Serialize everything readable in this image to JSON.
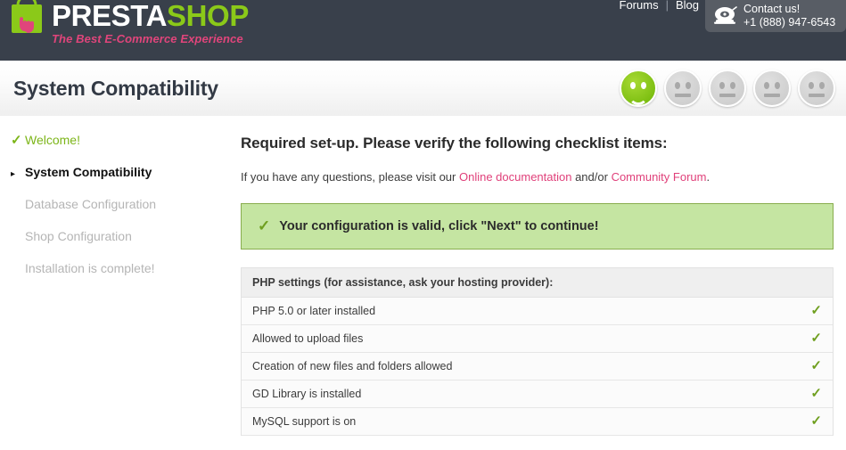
{
  "header": {
    "logo": {
      "brand_part1": "PRESTA",
      "brand_part2": "SHOP",
      "tagline": "The Best E-Commerce Experience",
      "bag_color": "#8bc919",
      "cursor_color": "#e0457b"
    },
    "links": [
      {
        "label": "Forums"
      },
      {
        "label": "Blog"
      }
    ],
    "separator": "|",
    "contact": {
      "icon": "telephone-icon",
      "title": "Contact us!",
      "phone": "+1 (888) 947-6543"
    },
    "background_color": "#39404b",
    "contact_box_color": "#585d65"
  },
  "titlebar": {
    "title": "System Compatibility",
    "progress": [
      {
        "state": "active",
        "mood": "smile"
      },
      {
        "state": "inactive",
        "mood": "flat"
      },
      {
        "state": "inactive",
        "mood": "flat"
      },
      {
        "state": "inactive",
        "mood": "flat"
      },
      {
        "state": "inactive",
        "mood": "flat"
      }
    ],
    "active_color": "#7dbf12",
    "inactive_color": "#d0d0d0"
  },
  "sidebar": {
    "items": [
      {
        "label": "Welcome!",
        "state": "done",
        "bullet": "✓"
      },
      {
        "label": "System Compatibility",
        "state": "current",
        "bullet": "▸"
      },
      {
        "label": "Database Configuration",
        "state": "todo",
        "bullet": ""
      },
      {
        "label": "Shop Configuration",
        "state": "todo",
        "bullet": ""
      },
      {
        "label": "Installation is complete!",
        "state": "todo",
        "bullet": ""
      }
    ]
  },
  "main": {
    "heading": "Required set-up. Please verify the following checklist items:",
    "intro": {
      "before": "If you have any questions, please visit our ",
      "link1": "Online documentation",
      "middle": " and/or ",
      "link2": "Community Forum",
      "after": ".",
      "link_color": "#e0407a"
    },
    "alert": {
      "icon": "check-icon",
      "text": "Your configuration is valid, click \"Next\" to continue!",
      "background": "#c5e5a2",
      "border": "#89ad4e"
    },
    "table": {
      "header": "PHP settings (for assistance, ask your hosting provider):",
      "rows": [
        {
          "label": "PHP 5.0 or later installed",
          "status": "✓"
        },
        {
          "label": "Allowed to upload files",
          "status": "✓"
        },
        {
          "label": "Creation of new files and folders allowed",
          "status": "✓"
        },
        {
          "label": "GD Library is installed",
          "status": "✓"
        },
        {
          "label": "MySQL support is on",
          "status": "✓"
        }
      ],
      "status_color": "#6f9f1f"
    }
  }
}
